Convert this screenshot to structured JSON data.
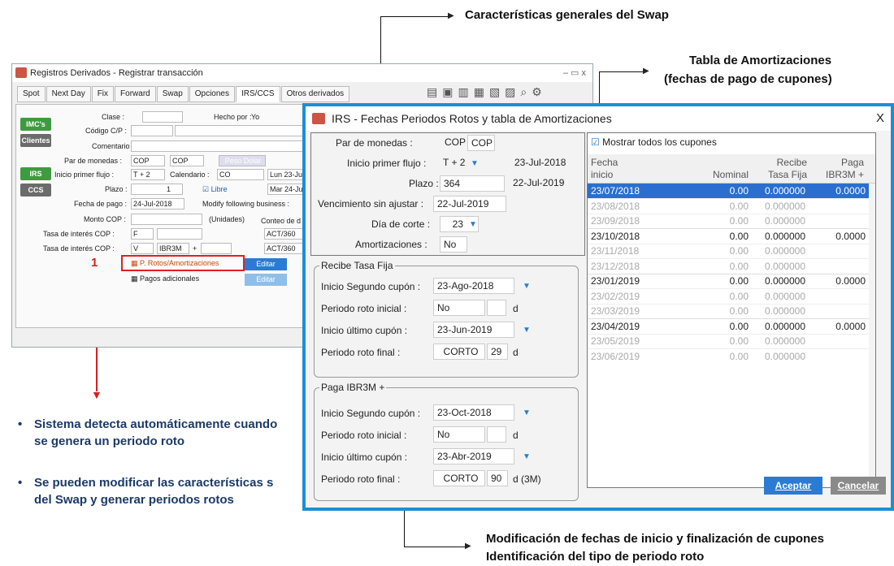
{
  "annotations": {
    "swap_general": "Características generales del Swap",
    "amort_table_1": "Tabla de Amortizaciones",
    "amort_table_2": "(fechas de pago de cupones)",
    "mod_dates_1": "Modificación de fechas de inicio y finalización de cupones",
    "mod_dates_2": "Identificación del tipo de periodo roto",
    "marker": "1",
    "bullet1": "Sistema detecta automáticamente cuando se genera un periodo roto",
    "bullet2": "Se pueden modificar las características s del Swap y generar periodos rotos"
  },
  "back_window": {
    "title": "Registros Derivados - Registrar transacción",
    "controls": "‒ ▭ x",
    "tabs": [
      "Spot",
      "Next Day",
      "Fix",
      "Forward",
      "Swap",
      "Opciones",
      "IRS/CCS",
      "Otros derivados"
    ],
    "side_buttons": [
      "IMC's",
      "Clientes",
      "IRS",
      "CCS"
    ],
    "labels": {
      "clase": "Clase :",
      "hecho_por": "Hecho por :",
      "hecho_val": "Yo",
      "codigo": "Código C/P :",
      "comentario": "Comentario :",
      "par": "Par de monedas :",
      "inicio": "Inicio primer flujo :",
      "calendario": "Calendario :",
      "plazo": "Plazo :",
      "fecha_pago": "Fecha de pago :",
      "modify": "Modify following business :",
      "monto": "Monto COP :",
      "unidades": "(Unidades)",
      "conteo": "Conteo de d",
      "tasa1": "Tasa de interés COP :",
      "tasa2": "Tasa de interés COP :"
    },
    "values": {
      "par1": "COP",
      "par2": "COP",
      "peso_dolar": "Peso Dolar",
      "inicio": "T + 2",
      "cal": "CO",
      "lun": "Lun 23-Jul",
      "plazo": "1",
      "libre": "Libre",
      "mar": "Mar 24-Jul",
      "fecha_pago": "24-Jul-2018",
      "act1": "ACT/360",
      "tasa_f": "F",
      "tasa_v": "V",
      "ibr": "IBR3M",
      "plus": "+",
      "act2": "ACT/360"
    },
    "checkbox_rotos": "P. Rotos/Amortizaciones",
    "checkbox_pagos": "Pagos adicionales",
    "editar": "Editar"
  },
  "front_window": {
    "title": "IRS - Fechas Periodos Rotos y tabla de Amortizaciones",
    "close": "X",
    "general": {
      "par_label": "Par de monedas :",
      "par1": "COP",
      "par2": "COP",
      "inicio_label": "Inicio primer flujo :",
      "inicio_val": "T + 2",
      "inicio_date": "23-Jul-2018",
      "plazo_label": "Plazo :",
      "plazo_val": "364",
      "plazo_date": "22-Jul-2019",
      "venc_label": "Vencimiento sin ajustar :",
      "venc_val": "22-Jul-2019",
      "dia_label": "Día de corte :",
      "dia_val": "23",
      "amort_label": "Amortizaciones :",
      "amort_val": "No"
    },
    "recibe": {
      "title": "Recibe Tasa Fija",
      "isc_label": "Inicio Segundo cupón :",
      "isc_val": "23-Ago-2018",
      "pri_label": "Periodo roto inicial :",
      "pri_val": "No",
      "pri_unit": "d",
      "iuc_label": "Inicio último cupón :",
      "iuc_val": "23-Jun-2019",
      "prf_label": "Periodo roto final :",
      "prf_val": "CORTO",
      "prf_num": "29",
      "prf_unit": "d"
    },
    "paga": {
      "title": "Paga IBR3M +",
      "isc_label": "Inicio Segundo cupón :",
      "isc_val": "23-Oct-2018",
      "pri_label": "Periodo roto inicial :",
      "pri_val": "No",
      "pri_unit": "d",
      "iuc_label": "Inicio último cupón :",
      "iuc_val": "23-Abr-2019",
      "prf_label": "Periodo roto final :",
      "prf_val": "CORTO",
      "prf_num": "90",
      "prf_unit": "d (3M)"
    },
    "table": {
      "show_all": "Mostrar todos los cupones",
      "headers": [
        [
          "Fecha",
          "inicio"
        ],
        [
          "",
          "Nominal"
        ],
        [
          "Recibe",
          "Tasa Fija"
        ],
        [
          "Paga",
          "IBR3M +"
        ]
      ],
      "rows": [
        [
          "23/07/2018",
          "0.00",
          "0.000000",
          "0.0000"
        ],
        [
          "23/08/2018",
          "0.00",
          "0.000000",
          ""
        ],
        [
          "23/09/2018",
          "0.00",
          "0.000000",
          ""
        ],
        [
          "23/10/2018",
          "0.00",
          "0.000000",
          "0.0000"
        ],
        [
          "23/11/2018",
          "0.00",
          "0.000000",
          ""
        ],
        [
          "23/12/2018",
          "0.00",
          "0.000000",
          ""
        ],
        [
          "23/01/2019",
          "0.00",
          "0.000000",
          "0.0000"
        ],
        [
          "23/02/2019",
          "0.00",
          "0.000000",
          ""
        ],
        [
          "23/03/2019",
          "0.00",
          "0.000000",
          ""
        ],
        [
          "23/04/2019",
          "0.00",
          "0.000000",
          "0.0000"
        ],
        [
          "23/05/2019",
          "0.00",
          "0.000000",
          ""
        ],
        [
          "23/06/2019",
          "0.00",
          "0.000000",
          ""
        ]
      ],
      "highlight_rows": [
        0,
        3,
        6,
        9
      ]
    },
    "aceptar": "Aceptar",
    "cancelar": "Cancelar"
  }
}
